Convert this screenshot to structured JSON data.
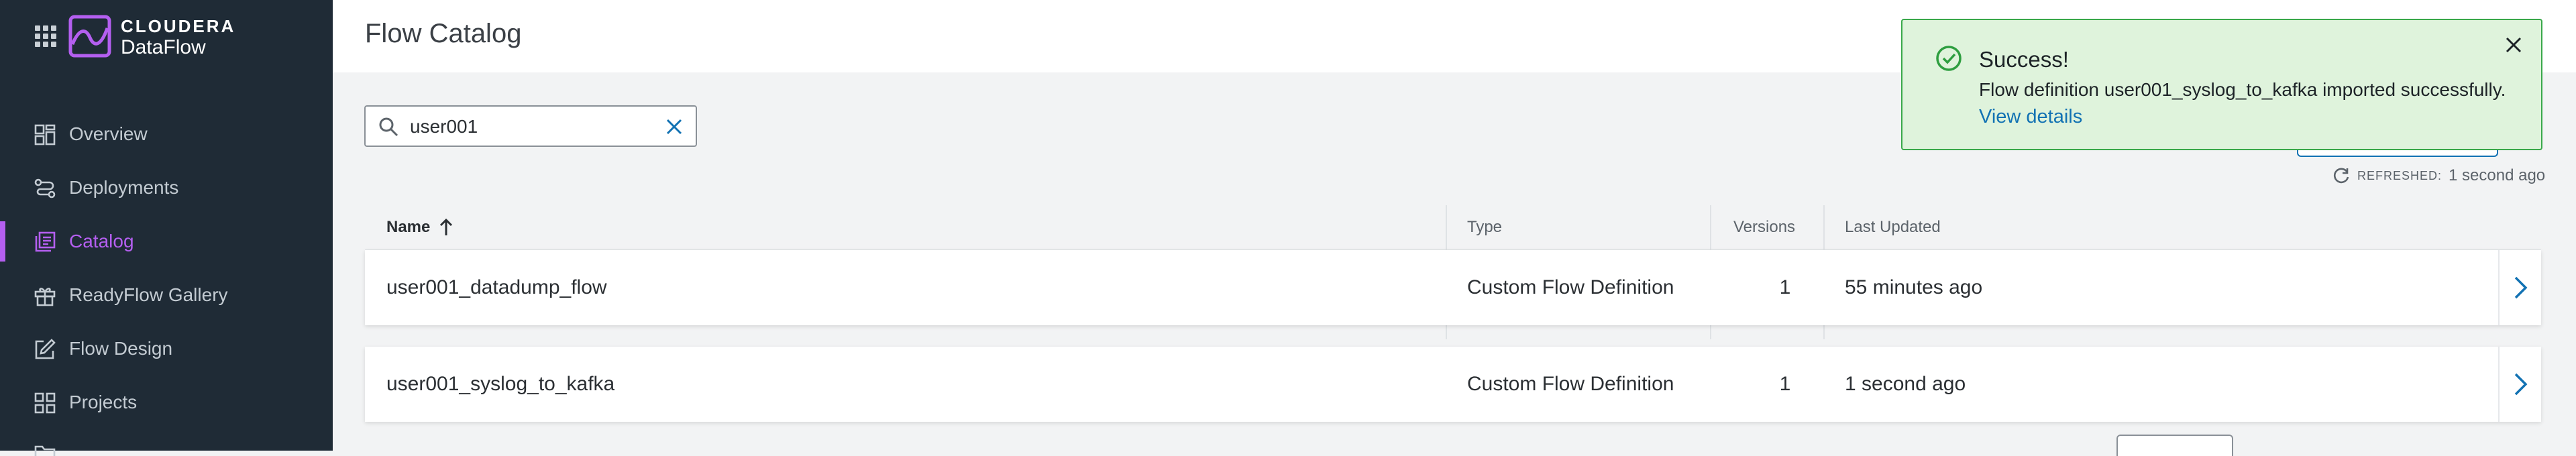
{
  "app": {
    "brand_top": "CLOUDERA",
    "brand_bottom": "DataFlow"
  },
  "sidebar": {
    "items": [
      {
        "label": "Overview",
        "icon": "overview-icon",
        "active": false
      },
      {
        "label": "Deployments",
        "icon": "deployments-icon",
        "active": false
      },
      {
        "label": "Catalog",
        "icon": "catalog-icon",
        "active": true
      },
      {
        "label": "ReadyFlow Gallery",
        "icon": "gift-icon",
        "active": false
      },
      {
        "label": "Flow Design",
        "icon": "edit-icon",
        "active": false
      },
      {
        "label": "Projects",
        "icon": "projects-icon",
        "active": false
      }
    ]
  },
  "page": {
    "title": "Flow Catalog"
  },
  "search": {
    "value": "user001",
    "placeholder": ""
  },
  "refresh": {
    "label": "REFRESHED:",
    "value": "1 second ago"
  },
  "table": {
    "headers": {
      "name": "Name",
      "type": "Type",
      "versions": "Versions",
      "updated": "Last Updated"
    },
    "rows": [
      {
        "name": "user001_datadump_flow",
        "type": "Custom Flow Definition",
        "versions": "1",
        "updated": "55 minutes ago"
      },
      {
        "name": "user001_syslog_to_kafka",
        "type": "Custom Flow Definition",
        "versions": "1",
        "updated": "1 second ago"
      }
    ]
  },
  "toast": {
    "title": "Success!",
    "message": "Flow definition user001_syslog_to_kafka imported successfully.",
    "link": "View details"
  },
  "colors": {
    "sidebar_bg": "#1f2b36",
    "accent": "#b45ff0",
    "link": "#1272b3",
    "success_bg": "#dff3dc",
    "success_border": "#39a84a"
  }
}
